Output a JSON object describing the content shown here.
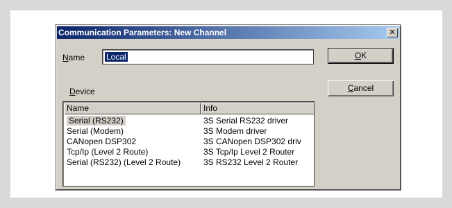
{
  "dialog": {
    "title": "Communication Parameters: New Channel",
    "close_glyph": "✕"
  },
  "name_field": {
    "label_mnemonic": "N",
    "label_rest": "ame",
    "value": "Local"
  },
  "buttons": {
    "ok_mnemonic": "O",
    "ok_rest": "K",
    "cancel_mnemonic": "C",
    "cancel_rest": "ancel"
  },
  "device": {
    "label_mnemonic": "D",
    "label_rest": "evice",
    "columns": [
      "Name",
      "Info"
    ],
    "rows": [
      {
        "name": "Serial (RS232)",
        "info": "3S Serial RS232 driver",
        "selected": true
      },
      {
        "name": "Serial (Modem)",
        "info": "3S Modem driver"
      },
      {
        "name": "CANopen DSP302",
        "info": "3S CANopen DSP302 driv"
      },
      {
        "name": "Tcp/Ip (Level 2 Route)",
        "info": "3S Tcp/Ip Level 2 Router"
      },
      {
        "name": "Serial (RS232) (Level 2 Route)",
        "info": "3S RS232 Level 2 Router"
      }
    ]
  }
}
